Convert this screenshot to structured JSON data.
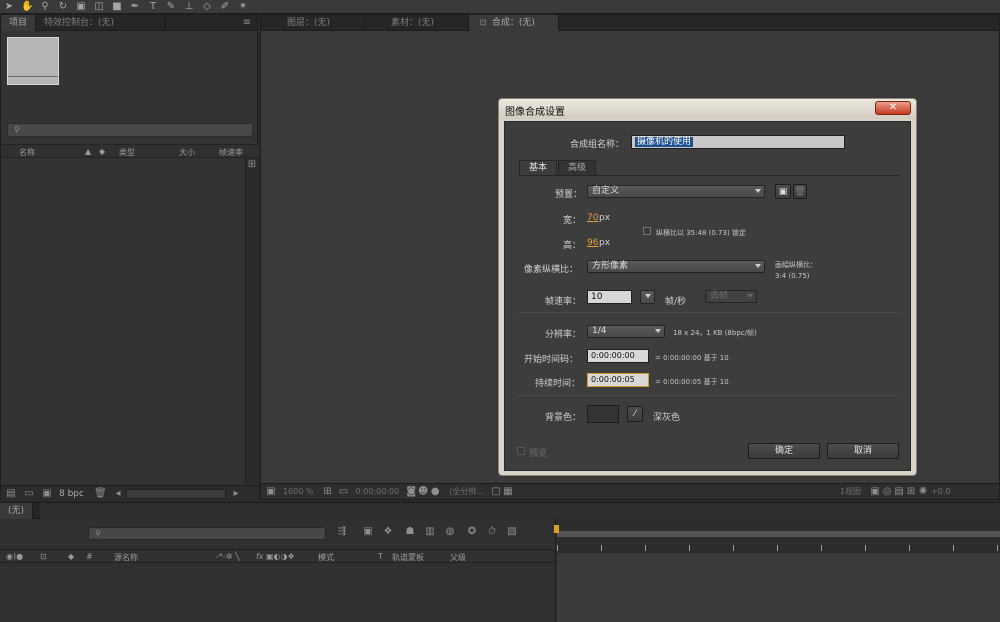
{
  "project_panel": {
    "tabs": [
      "项目",
      "特效控制台：(无)"
    ],
    "columns": [
      "名称",
      "类型",
      "大小",
      "帧速率"
    ],
    "footer_bpc": "8 bpc"
  },
  "viewer": {
    "tabs": [
      "图层：(无)",
      "素材：(无)",
      "合成：(无)"
    ],
    "footer_zoom": "1600 %",
    "footer_time": "0:00:00:00",
    "footer_quality": "(全分辨...",
    "footer_view": "1视图",
    "footer_offset": "+0.0"
  },
  "timeline": {
    "tab": "(无)",
    "columns": [
      "源名称",
      "模式",
      "T",
      "轨道蒙板",
      "父级"
    ],
    "hash": "#",
    "fx": "fx"
  },
  "dialog": {
    "title": "图像合成设置",
    "name_label": "合成组名称：",
    "name_value": "摄像机的使用",
    "tabs": [
      "基本",
      "高级"
    ],
    "preset_label": "预置：",
    "preset_value": "自定义",
    "width_label": "宽：",
    "width_value": "70",
    "height_label": "高：",
    "height_value": "96",
    "unit_px": "px",
    "lock_ratio": "纵横比以 35:48 (0.73) 锁定",
    "pixel_ratio_label": "像素纵横比：",
    "pixel_ratio_value": "方形像素",
    "frame_ratio_label": "画幅纵横比：",
    "frame_ratio_value": "3:4 (0.75)",
    "fps_label": "帧速率：",
    "fps_value": "10",
    "fps_unit": "帧/秒",
    "fps_drop": "丢帧",
    "res_label": "分辨率：",
    "res_value": "1/4",
    "res_info": "18 x 24，1 KB (8bpc/帧)",
    "start_label": "开始时间码：",
    "start_value": "0:00:00:00",
    "start_info": "= 0:00:00:00  基于 10",
    "dur_label": "持续时间：",
    "dur_value": "0:00:00:05",
    "dur_info": "= 0:00:00:05  基于 10",
    "bg_label": "背景色：",
    "bg_name": "深灰色",
    "preview_label": "预览",
    "ok": "确定",
    "cancel": "取消"
  }
}
